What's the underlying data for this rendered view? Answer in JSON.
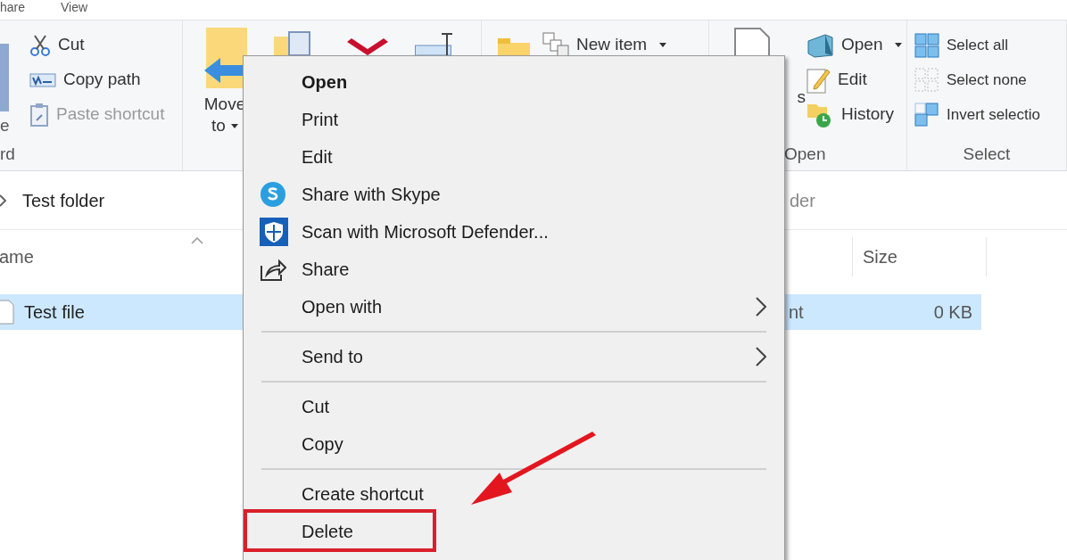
{
  "tabs": [
    {
      "label": "hare"
    },
    {
      "label": "View"
    }
  ],
  "ribbon": {
    "groups": [
      {
        "label": "rd",
        "large": [
          {
            "lines": [
              "e"
            ]
          }
        ],
        "small": [
          {
            "label": "Cut",
            "disabled": false,
            "dropdown": false
          },
          {
            "label": "Copy path",
            "disabled": false,
            "dropdown": false
          },
          {
            "label": "Paste shortcut",
            "disabled": true,
            "dropdown": false
          }
        ]
      },
      {
        "large": [
          {
            "lines": [
              "Move",
              "to"
            ],
            "dropdown": true
          }
        ]
      },
      {
        "small": [
          {
            "label": "New item",
            "disabled": false,
            "dropdown": true
          }
        ]
      },
      {
        "label": "Open",
        "large": [
          {
            "lines": [
              "s"
            ]
          }
        ],
        "small": [
          {
            "label": "Open",
            "disabled": false,
            "dropdown": true
          },
          {
            "label": "Edit",
            "disabled": false,
            "dropdown": false
          },
          {
            "label": "History",
            "disabled": false,
            "dropdown": false
          }
        ]
      },
      {
        "label": "Select",
        "small": [
          {
            "label": "Select all",
            "disabled": false,
            "dropdown": false
          },
          {
            "label": "Select none",
            "disabled": false,
            "dropdown": false
          },
          {
            "label": "Invert selectio",
            "disabled": false,
            "dropdown": false
          }
        ]
      }
    ]
  },
  "address": {
    "path": "Test folder",
    "tail": "der"
  },
  "columns": [
    {
      "label": "ame",
      "sorted_ascending": true
    },
    {
      "label": "Size"
    }
  ],
  "rows": [
    {
      "name": "Test file",
      "column_2": "nt",
      "size": "0 KB",
      "selected": true
    }
  ],
  "menu": {
    "items": [
      {
        "kind": "item",
        "label": "Open",
        "default": true,
        "submenu": false,
        "highlighted": false
      },
      {
        "kind": "item",
        "label": "Print",
        "default": false,
        "submenu": false,
        "highlighted": false
      },
      {
        "kind": "item",
        "label": "Edit",
        "default": false,
        "submenu": false,
        "highlighted": false
      },
      {
        "kind": "item",
        "label": "Share with Skype",
        "default": false,
        "submenu": false,
        "highlighted": false
      },
      {
        "kind": "item",
        "label": "Scan with Microsoft Defender...",
        "default": false,
        "submenu": false,
        "highlighted": false
      },
      {
        "kind": "item",
        "label": "Share",
        "default": false,
        "submenu": false,
        "highlighted": false
      },
      {
        "kind": "item",
        "label": "Open with",
        "default": false,
        "submenu": true,
        "highlighted": false
      },
      {
        "kind": "separator"
      },
      {
        "kind": "item",
        "label": "Send to",
        "default": false,
        "submenu": true,
        "highlighted": false
      },
      {
        "kind": "separator"
      },
      {
        "kind": "item",
        "label": "Cut",
        "default": false,
        "submenu": false,
        "highlighted": false
      },
      {
        "kind": "item",
        "label": "Copy",
        "default": false,
        "submenu": false,
        "highlighted": false
      },
      {
        "kind": "separator"
      },
      {
        "kind": "item",
        "label": "Create shortcut",
        "default": false,
        "submenu": false,
        "highlighted": false
      },
      {
        "kind": "item",
        "label": "Delete",
        "default": false,
        "submenu": false,
        "highlighted": true
      }
    ]
  }
}
